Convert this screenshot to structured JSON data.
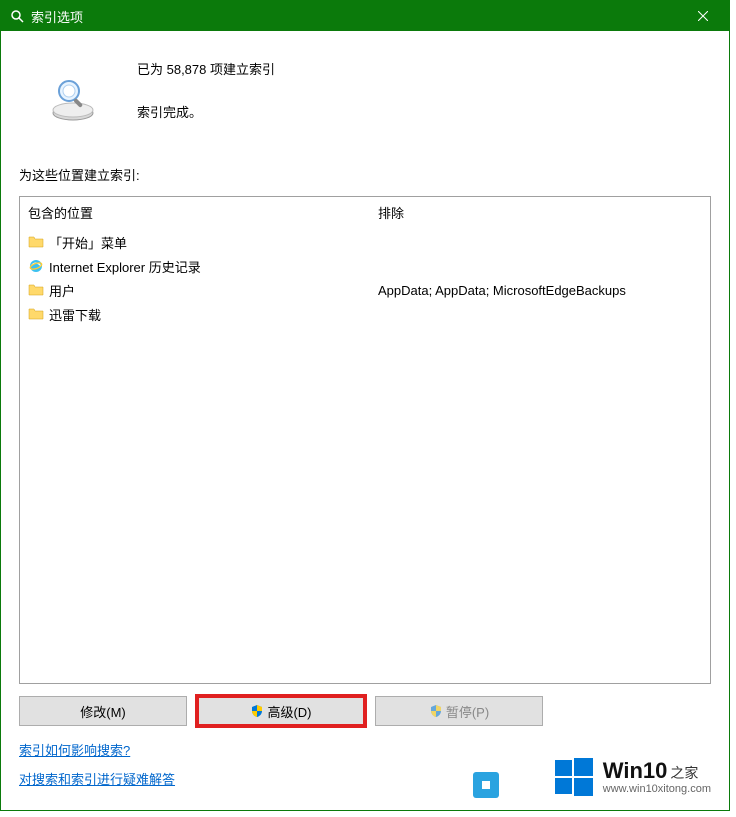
{
  "title": "索引选项",
  "status": {
    "line1": "已为 58,878 项建立索引",
    "line2": "索引完成。"
  },
  "section_label": "为这些位置建立索引:",
  "columns": {
    "included": "包含的位置",
    "excluded": "排除"
  },
  "items": [
    {
      "icon": "folder",
      "label": "「开始」菜单",
      "exclude": ""
    },
    {
      "icon": "ie",
      "label": "Internet Explorer 历史记录",
      "exclude": ""
    },
    {
      "icon": "folder",
      "label": "用户",
      "exclude": "AppData; AppData; MicrosoftEdgeBackups"
    },
    {
      "icon": "folder",
      "label": "迅雷下载",
      "exclude": ""
    }
  ],
  "buttons": {
    "modify": "修改(M)",
    "advanced": "高级(D)",
    "pause": "暂停(P)"
  },
  "links": {
    "how": "索引如何影响搜索?",
    "troubleshoot": "对搜索和索引进行疑难解答"
  },
  "watermark": {
    "brand": "Win10",
    "suffix": "之家",
    "url": "www.win10xitong.com"
  }
}
